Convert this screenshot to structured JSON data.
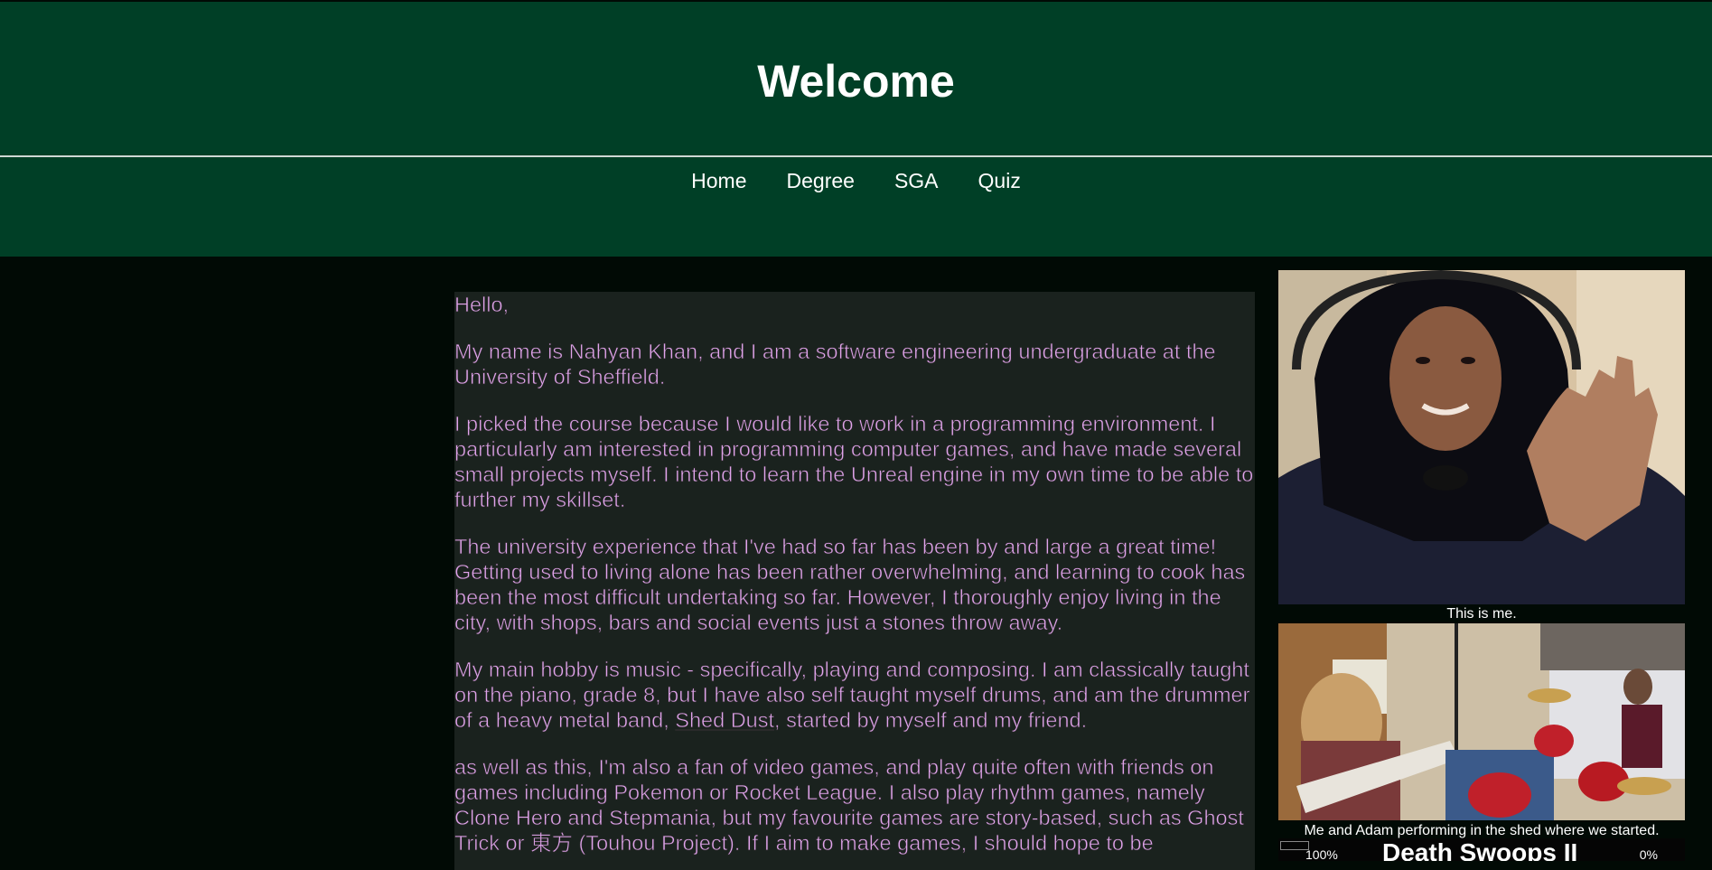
{
  "header": {
    "title": "Welcome"
  },
  "nav": {
    "items": [
      {
        "label": "Home"
      },
      {
        "label": "Degree"
      },
      {
        "label": "SGA"
      },
      {
        "label": "Quiz"
      }
    ]
  },
  "main": {
    "greeting": "Hello,",
    "p1": "My name is Nahyan Khan, and I am a software engineering undergraduate at the University of Sheffield.",
    "p2": "I picked the course because I would like to work in a programming environment. I particularly am interested in programming computer games, and have made several small projects myself. I intend to learn the Unreal engine in my own time to be able to further my skillset.",
    "p3": "The university experience that I've had so far has been by and large a great time! Getting used to living alone has been rather overwhelming, and learning to cook has been the most difficult undertaking so far. However, I thoroughly enjoy living in the city, with shops, bars and social events just a stones throw away.",
    "p4_before": "My main hobby is music - specifically, playing and composing. I am classically taught on the piano, grade 8, but I have also self taught myself drums, and am the drummer of a heavy metal band, ",
    "p4_link": "Shed Dust",
    "p4_after": ", started by myself and my friend.",
    "p5": "as well as this, I'm also a fan of video games, and play quite often with friends on games including Pokemon or Rocket League. I also play rhythm games, namely Clone Hero and Stepmania, but my favourite games are story-based, such as Ghost Trick or 東方 (Touhou Project). If I aim to make games, I should hope to be"
  },
  "sidebar": {
    "caption1": "This is me.",
    "caption2": "Me and Adam performing in the shed where we started.",
    "video_title": "Death Swoops II",
    "video_left": "100%",
    "video_right": "0%"
  }
}
